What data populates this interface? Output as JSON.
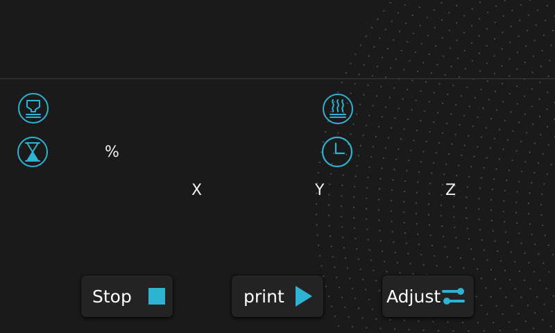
{
  "theme": {
    "accent": "#2fb3d3",
    "background": "#1a1a1b",
    "dot_color": "#3e6c78"
  },
  "status": {
    "nozzle_icon": "nozzle-temperature-icon",
    "bed_icon": "bed-heat-icon",
    "progress_icon": "hourglass-icon",
    "progress_percent_symbol": "%",
    "time_icon": "clock-icon"
  },
  "axes": {
    "x_label": "X",
    "y_label": "Y",
    "z_label": "Z"
  },
  "controls": {
    "stop_label": "Stop",
    "stop_icon": "stop-square-icon",
    "print_label": "print",
    "print_icon": "play-triangle-icon",
    "adjust_label": "Adjust",
    "adjust_icon": "sliders-icon"
  }
}
